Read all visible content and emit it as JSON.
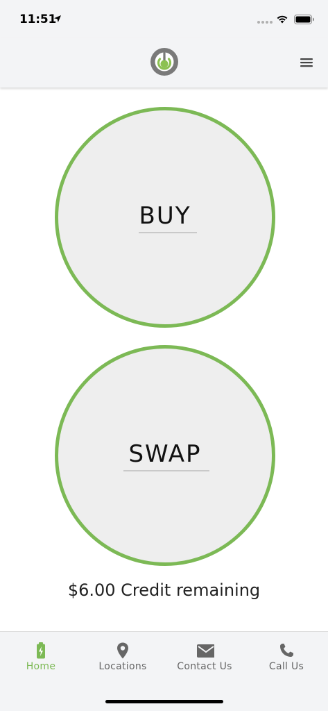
{
  "status_bar": {
    "time": "11:51",
    "icons": [
      "location-arrow-icon",
      "signal-dots-icon",
      "wifi-icon",
      "battery-icon"
    ]
  },
  "header": {
    "logo": "power-button-logo",
    "menu_icon": "hamburger-menu-icon"
  },
  "main": {
    "buy_label": "BUY",
    "swap_label": "SWAP",
    "credit_text": "$6.00 Credit remaining"
  },
  "tabs": [
    {
      "label": "Home",
      "icon": "battery-charging-icon",
      "active": true
    },
    {
      "label": "Locations",
      "icon": "map-pin-icon",
      "active": false
    },
    {
      "label": "Contact Us",
      "icon": "envelope-icon",
      "active": false
    },
    {
      "label": "Call Us",
      "icon": "phone-icon",
      "active": false
    }
  ],
  "colors": {
    "accent": "#7cb955",
    "circle_fill": "#eeeeee",
    "bar_background": "#f3f4f6",
    "inactive_tab": "#666666"
  }
}
